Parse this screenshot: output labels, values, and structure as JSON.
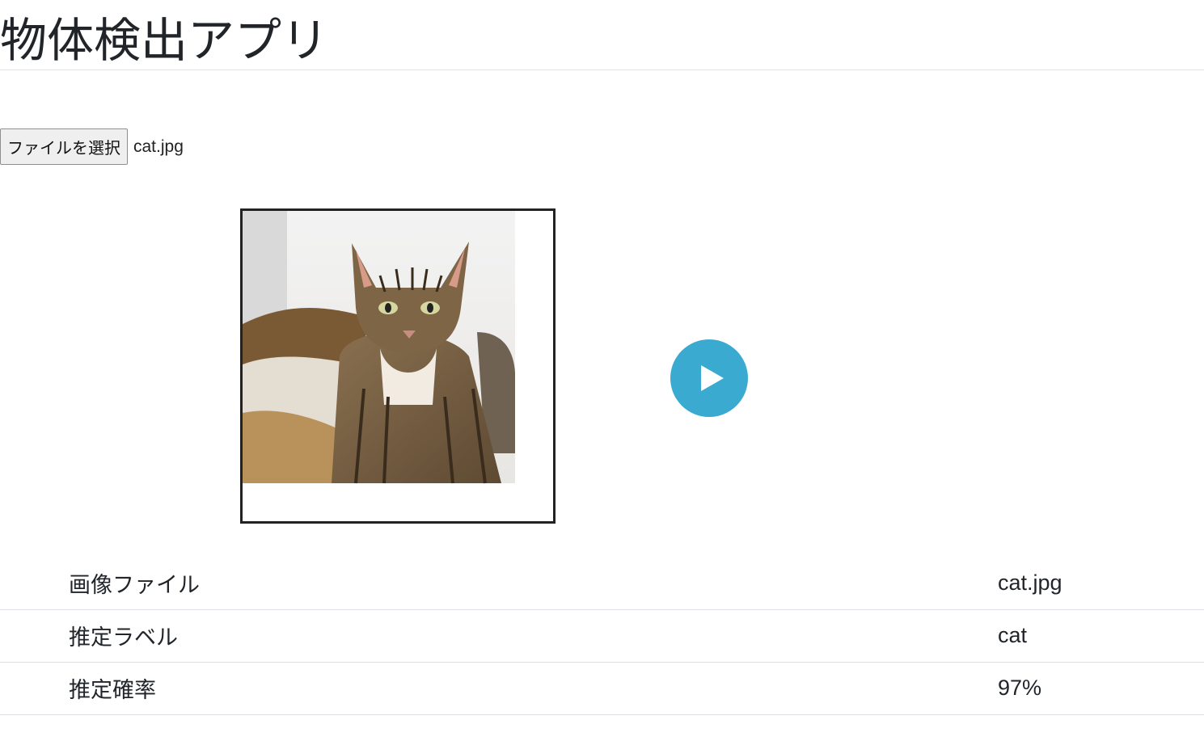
{
  "page": {
    "title": "物体検出アプリ"
  },
  "file_input": {
    "button_label": "ファイルを選択",
    "selected_file": "cat.jpg"
  },
  "preview": {
    "subject": "cat-photo"
  },
  "run_button": {
    "icon": "play-icon",
    "color": "#3aaad1"
  },
  "results": {
    "rows": [
      {
        "label": "画像ファイル",
        "value": "cat.jpg"
      },
      {
        "label": "推定ラベル",
        "value": "cat"
      },
      {
        "label": "推定確率",
        "value": "97%"
      }
    ]
  }
}
